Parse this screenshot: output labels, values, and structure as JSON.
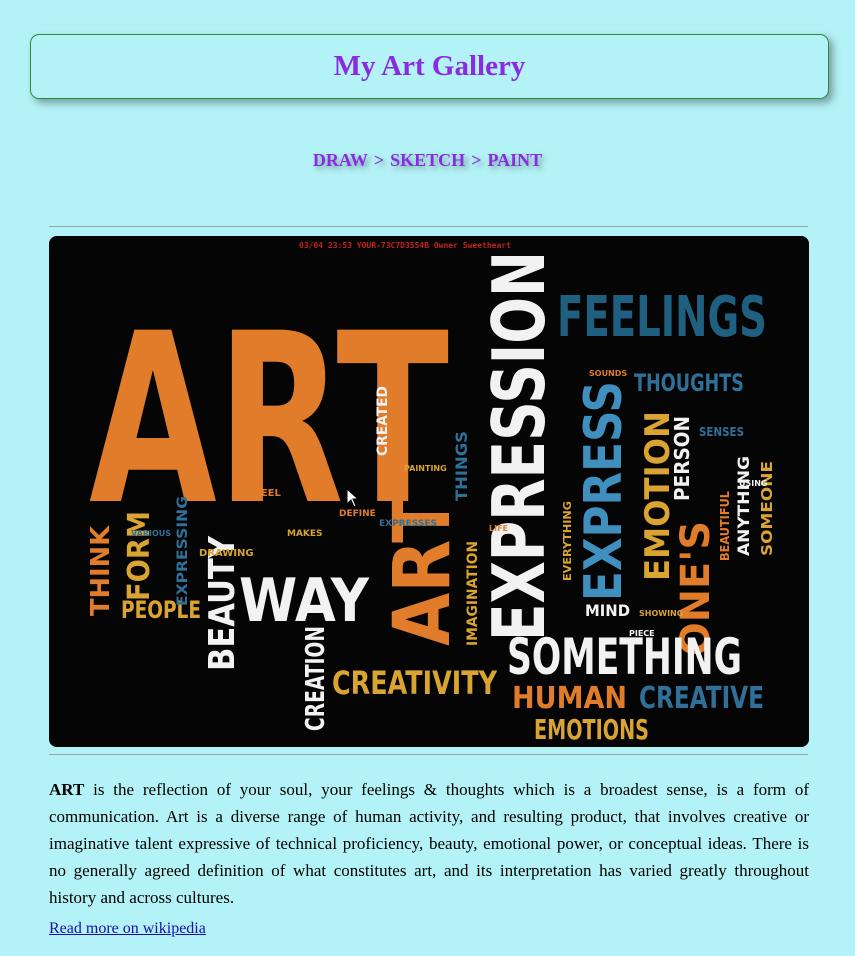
{
  "header": {
    "title": "My Art Gallery"
  },
  "breadcrumb": {
    "items": [
      "DRAW",
      "SKETCH",
      "PAINT"
    ],
    "separator": ">"
  },
  "image": {
    "status_text": "03/04 23:53  YOUR-73C7D3554B  Owner  Sweetheart"
  },
  "article": {
    "lead_word": "ART",
    "text": " is the reflection of your soul, your feelings & thoughts which is a broadest sense, is a form of communication. Art is a diverse range of human activity, and resulting product, that involves creative or imaginative talent expressive of technical proficiency, beauty, emotional power, or conceptual ideas. There is no generally agreed definition of what constitutes art, and its interpretation has varied greatly throughout history and across cultures.",
    "link_text": "Read more on wikipedia"
  },
  "colors": {
    "background": "#b3f2f6",
    "title": "#8a2be2",
    "link": "#1a0dab",
    "header_border": "#2e8b3c",
    "art_orange": "#e07c2a",
    "art_blue": "#3f7fa6",
    "art_white": "#f2f2f2",
    "art_gold": "#d9a431"
  }
}
